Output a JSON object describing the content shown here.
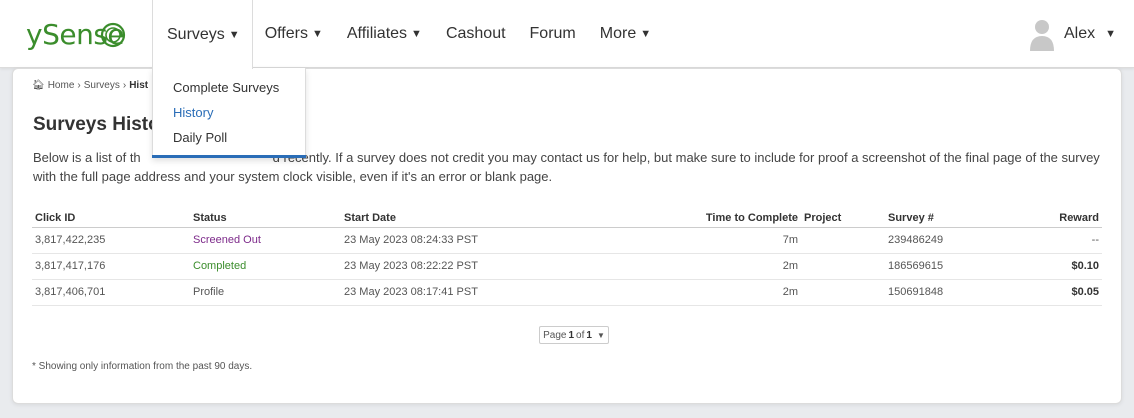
{
  "logo": {
    "text": "ySense"
  },
  "nav": {
    "surveys": "Surveys",
    "offers": "Offers",
    "affiliates": "Affiliates",
    "cashout": "Cashout",
    "forum": "Forum",
    "more": "More"
  },
  "user": {
    "name": "Alex"
  },
  "dropdown": {
    "items": [
      "Complete Surveys",
      "History",
      "Daily Poll"
    ]
  },
  "breadcrumb": {
    "home": "Home",
    "surveys": "Surveys",
    "current": "Hist"
  },
  "page": {
    "title": "Surveys Histo",
    "description_start": "Below is a list of th",
    "description_rest": "d recently. If a survey does not credit you may contact us for help, but make sure to include for proof a screenshot of the final page of the survey with the full page address and your system clock visible, even if it's an error or blank page."
  },
  "table": {
    "headers": [
      "Click ID",
      "Status",
      "Start Date",
      "Time to Complete",
      "Project",
      "Survey #",
      "Reward"
    ],
    "rows": [
      [
        "3,817,422,235",
        "Screened Out",
        "23 May 2023 08:24:33 PST",
        "7m",
        "",
        "239486249",
        "--"
      ],
      [
        "3,817,417,176",
        "Completed",
        "23 May 2023 08:22:22 PST",
        "2m",
        "",
        "186569615",
        "$0.10"
      ],
      [
        "3,817,406,701",
        "Profile",
        "23 May 2023 08:17:41 PST",
        "2m",
        "",
        "150691848",
        "$0.05"
      ]
    ]
  },
  "pager": {
    "prefix": "Page",
    "current": "1",
    "of": "of",
    "total": "1"
  },
  "footnote": "* Showing only information from the past 90 days.",
  "colors": {
    "brand": "#3b8d2c",
    "link": "#2a6db7",
    "screened": "#7d2a8a"
  }
}
